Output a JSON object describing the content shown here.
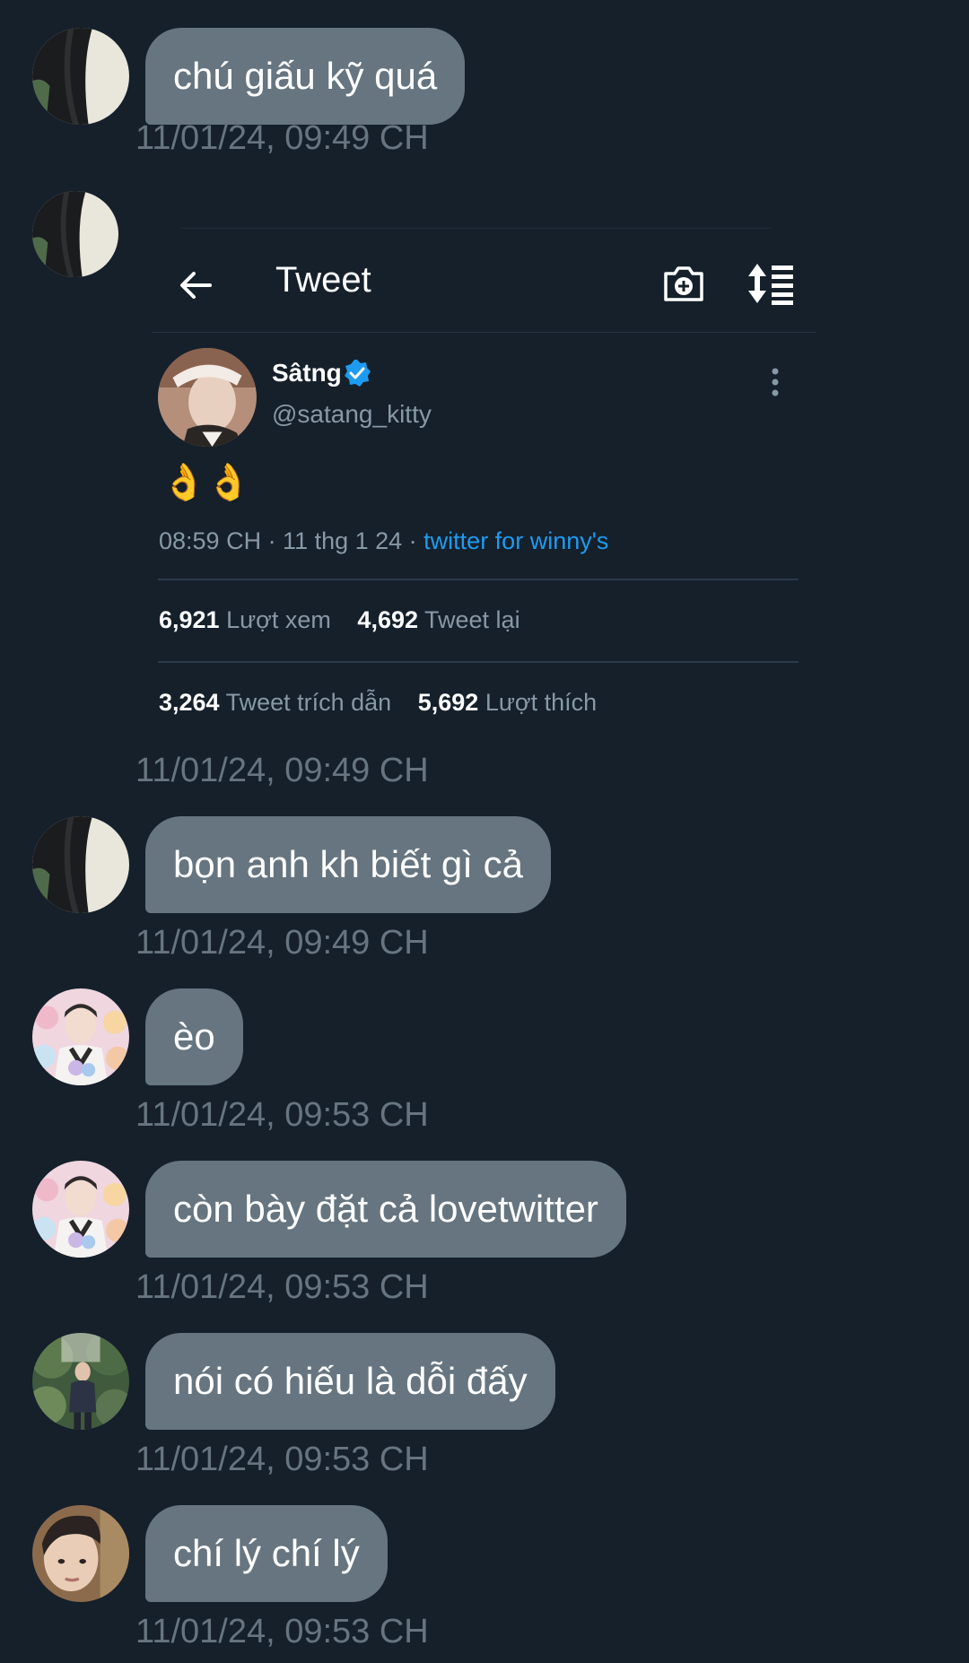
{
  "messages": [
    {
      "text": "chú giấu kỹ quá",
      "time": "11/01/24, 09:49 CH",
      "avatar": "avatar-dark-photo"
    },
    {
      "text": "",
      "time": "11/01/24, 09:49 CH",
      "avatar": "avatar-dark-photo"
    },
    {
      "text": "bọn anh kh biết gì cả",
      "time": "11/01/24, 09:49 CH",
      "avatar": "avatar-dark-photo"
    },
    {
      "text": "èo",
      "time": "11/01/24, 09:53 CH",
      "avatar": "avatar-plushies-photo"
    },
    {
      "text": "còn bày đặt cả lovetwitter",
      "time": "11/01/24, 09:53 CH",
      "avatar": "avatar-plushies-photo"
    },
    {
      "text": "nói có hiếu là dỗi đấy",
      "time": "11/01/24, 09:53 CH",
      "avatar": "avatar-forest-photo"
    },
    {
      "text": "chí lý chí lý",
      "time": "11/01/24, 09:53 CH",
      "avatar": "avatar-selfie-photo"
    }
  ],
  "tweet": {
    "header_title": "Tweet",
    "author_name": "Sâtng",
    "author_handle": "@satang_kitty",
    "content": "👌👌",
    "time_date": "08:59 CH · 11 thg 1 24 · ",
    "source": "twitter for winny's",
    "views_count": "6,921",
    "views_label": "Lượt xem",
    "retweets_count": "4,692",
    "retweets_label": "Tweet lại",
    "quotes_count": "3,264",
    "quotes_label": "Tweet trích dẫn",
    "likes_count": "5,692",
    "likes_label": "Lượt thích"
  },
  "colors": {
    "background": "#15202b",
    "bubble": "#66757f",
    "timestamp": "#66757f",
    "link": "#1d9bf0",
    "verified": "#1d9bf0"
  }
}
